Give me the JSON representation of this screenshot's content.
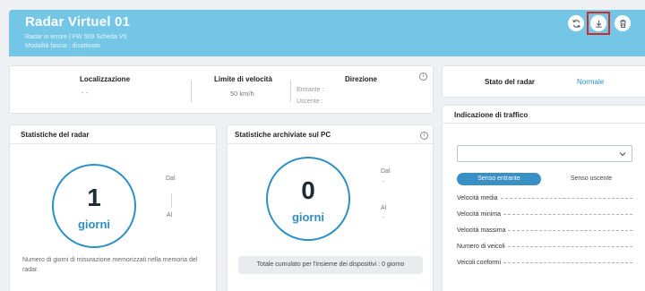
{
  "header": {
    "title": "Radar Virtuel 01",
    "subtitle_line1": "Radar in errore | FW 509  Scheda V5",
    "subtitle_line2": "Modalità fascia : disattivato",
    "buttons": [
      "refresh-icon",
      "download-icon",
      "trash-icon"
    ]
  },
  "info_card": {
    "location_label": "Localizzazione",
    "location_value": "- -",
    "speed_limit_label": "Limite di velocità",
    "speed_limit_value": "50 km/h",
    "direction_label": "Direzione",
    "incoming_label": "Entrante :",
    "outgoing_label": "Uscente :"
  },
  "status_card": {
    "label": "Stato del radar",
    "value": "Normale"
  },
  "radar_stats": {
    "title": "Statistiche del radar",
    "count": "1",
    "unit": "giorni",
    "from_label": "Dal",
    "to_label": "Al",
    "note": "Numero di giorni di misurazione memorizzati nella memoria del radar."
  },
  "pc_stats": {
    "title": "Statistiche archiviate sul PC",
    "count": "0",
    "unit": "giorni",
    "from_label": "Dal",
    "from_value": "-",
    "to_label": "Al",
    "to_value": "-",
    "note": "Totale cumulato per l'insieme dei dispositivi : 0 giorno"
  },
  "traffic": {
    "title": "Indicazione di traffico",
    "select_value": "",
    "tab_incoming": "Senso entrante",
    "tab_outgoing": "Senso uscente",
    "rows": [
      "Velocità media",
      "Velocità minima",
      "Velocità massima",
      "Numero di veicoli",
      "Veicoli conformi"
    ]
  },
  "colors": {
    "header_bg": "#73c6e5",
    "accent": "#2e8fc4",
    "highlight_frame": "#d12a2a"
  }
}
